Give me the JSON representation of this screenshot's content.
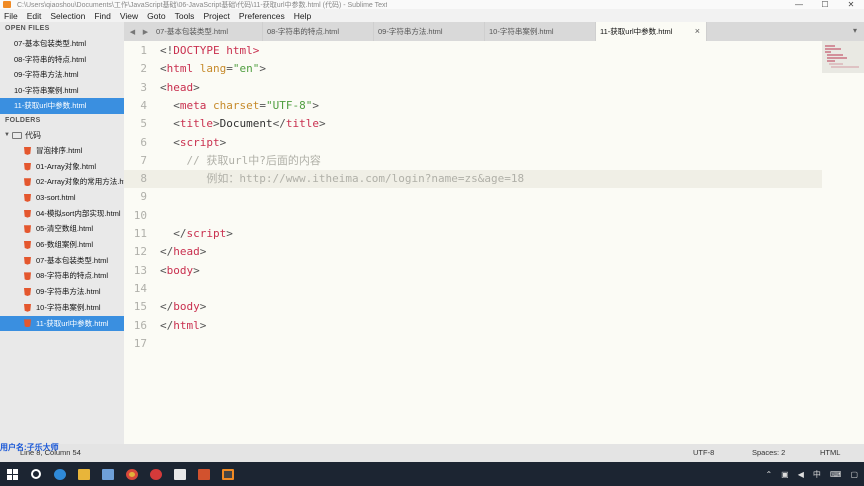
{
  "window": {
    "title": "C:\\Users\\qiaoshou\\Documents\\工作\\JavaScript基础\\06-JavaScript基础\\代码\\11-获取url中参数.html (代码) - Sublime Text",
    "controls": [
      "—",
      "☐",
      "✕"
    ]
  },
  "menu": [
    "File",
    "Edit",
    "Selection",
    "Find",
    "View",
    "Goto",
    "Tools",
    "Project",
    "Preferences",
    "Help"
  ],
  "sidebar": {
    "open_files_label": "OPEN FILES",
    "open_files": [
      "07-基本包装类型.html",
      "08-字符串的特点.html",
      "09-字符串方法.html",
      "10-字符串案例.html",
      "11-获取url中参数.html"
    ],
    "open_active_index": 4,
    "folders_label": "FOLDERS",
    "root_folder": "代码",
    "files": [
      "冒泡排序.html",
      "01-Array对象.html",
      "02-Array对象的常用方法.html",
      "03-sort.html",
      "04-模拟sort内部实现.html",
      "05-清空数组.html",
      "06-数组案例.html",
      "07-基本包装类型.html",
      "08-字符串的特点.html",
      "09-字符串方法.html",
      "10-字符串案例.html",
      "11-获取url中参数.html"
    ],
    "files_active_index": 11
  },
  "tabs": [
    {
      "label": "07-基本包装类型.html",
      "active": false
    },
    {
      "label": "08-字符串的特点.html",
      "active": false
    },
    {
      "label": "09-字符串方法.html",
      "active": false
    },
    {
      "label": "10-字符串案例.html",
      "active": false
    },
    {
      "label": "11-获取url中参数.html",
      "active": true
    }
  ],
  "editor": {
    "line_numbers": [
      "1",
      "2",
      "3",
      "4",
      "5",
      "6",
      "7",
      "8",
      "9",
      "10",
      "11",
      "12",
      "13",
      "14",
      "15",
      "16",
      "17"
    ],
    "highlighted_line": 8,
    "code": {
      "l1_open": "<!",
      "l1_tag": "DOCTYPE",
      "l1_rest": " html>",
      "l2_lt": "<",
      "l2_tag": "html",
      "l2_attr": " lang",
      "l2_eq": "=",
      "l2_val": "\"en\"",
      "l2_gt": ">",
      "l3_tag": "head",
      "l4_tag": "meta",
      "l4_attr": " charset",
      "l4_val": "\"UTF-8\"",
      "l5_tag": "title",
      "l5_text": "Document",
      "l6_tag": "script",
      "l7_comment": "// 获取url中?后面的内容",
      "l8_comment": "例如：http://www.itheima.com/login?name=zs&age=18",
      "l11_tag": "script",
      "l12_tag": "head",
      "l13_tag": "body",
      "l15_tag": "body",
      "l16_tag": "html"
    }
  },
  "status": {
    "position": "Line 8, Column 54",
    "encoding": "UTF-8",
    "spaces": "Spaces: 2",
    "syntax": "HTML"
  },
  "watermark": "用户名:子乐大师",
  "tray": {
    "ime": "中",
    "clock": "⌂"
  },
  "colors": {
    "accent": "#3a8fe0",
    "tag": "#c9304f",
    "attr": "#c78b2c",
    "string": "#4f9e3f",
    "taskbar": "#1c2532"
  }
}
